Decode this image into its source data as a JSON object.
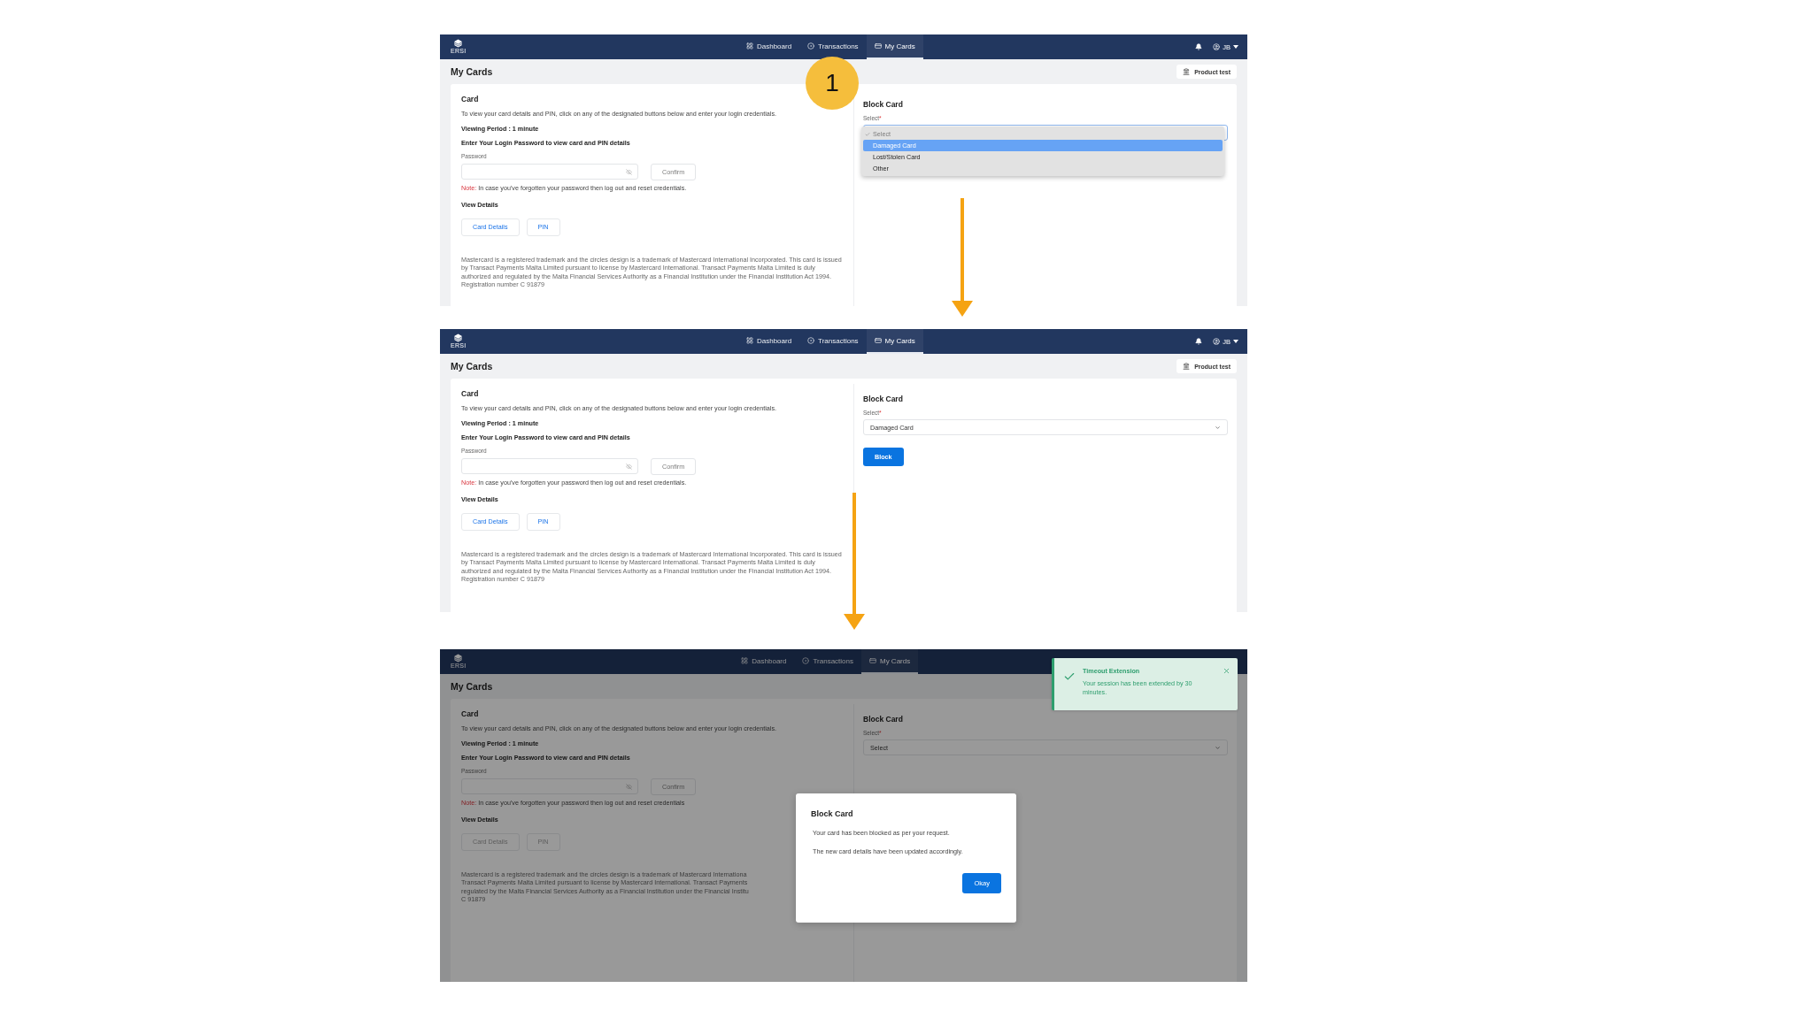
{
  "step_badge": "1",
  "screens": [
    {
      "nav": {
        "logo": "ERSI",
        "items": [
          {
            "label": "Dashboard",
            "selected": false
          },
          {
            "label": "Transactions",
            "selected": false
          },
          {
            "label": "My Cards",
            "selected": true
          }
        ],
        "user": "JB"
      },
      "page_title": "My Cards",
      "product_button": "Product test",
      "card": {
        "title": "Card",
        "intro": "To view your card details and PIN, click on any of the designated buttons below and enter your login credentials.",
        "viewing_period": "Viewing Period : 1 minute",
        "password_heading": "Enter Your Login Password to view card and PIN details",
        "password_label": "Password",
        "confirm": "Confirm",
        "note_label": "Note:",
        "note": "In case you've forgotten your password then log out and reset credentials.",
        "view_details": "View Details",
        "buttons": [
          {
            "label": "Card Details",
            "disabled": false
          },
          {
            "label": "PIN",
            "disabled": false
          }
        ],
        "disclaimer": "Mastercard is a registered trademark and the circles design is a trademark of Mastercard International Incorporated. This card is issued by Transact Payments Malta Limited pursuant to license by Mastercard International. Transact Payments Malta Limited is duly authorized and regulated by the Malta Financial Services Authority as a Financial Institution under the Financial Institution Act 1994. Registration number C 91879"
      },
      "block": {
        "title": "Block Card",
        "select_label": "Select",
        "required_mark": "*",
        "options": [
          {
            "label": "Select",
            "checked": true,
            "selected": false,
            "disabled": true
          },
          {
            "label": "Damaged Card",
            "checked": false,
            "selected": true,
            "disabled": false
          },
          {
            "label": "Lost/Stolen Card",
            "checked": false,
            "selected": false,
            "disabled": false
          },
          {
            "label": "Other",
            "checked": false,
            "selected": false,
            "disabled": false
          }
        ]
      }
    },
    {
      "nav": {
        "logo": "ERSI",
        "items": [
          {
            "label": "Dashboard",
            "selected": false
          },
          {
            "label": "Transactions",
            "selected": false
          },
          {
            "label": "My Cards",
            "selected": true
          }
        ],
        "user": "JB"
      },
      "page_title": "My Cards",
      "product_button": "Product test",
      "card": {
        "title": "Card",
        "intro": "To view your card details and PIN, click on any of the designated buttons below and enter your login credentials.",
        "viewing_period": "Viewing Period : 1 minute",
        "password_heading": "Enter Your Login Password to view card and PIN details",
        "password_label": "Password",
        "confirm": "Confirm",
        "note_label": "Note:",
        "note": "In case you've forgotten your password then log out and reset credentials.",
        "view_details": "View Details",
        "buttons": [
          {
            "label": "Card Details",
            "disabled": false
          },
          {
            "label": "PIN",
            "disabled": false
          }
        ],
        "disclaimer": "Mastercard is a registered trademark and the circles design is a trademark of Mastercard International Incorporated. This card is issued by Transact Payments Malta Limited pursuant to license by Mastercard International. Transact Payments Malta Limited is duly authorized and regulated by the Malta Financial Services Authority as a Financial Institution under the Financial Institution Act 1994. Registration number C 91879"
      },
      "block": {
        "title": "Block Card",
        "select_label": "Select",
        "required_mark": "*",
        "value": "Damaged Card",
        "block_button": "Block"
      }
    },
    {
      "nav": {
        "logo": "ERSI",
        "items": [
          {
            "label": "Dashboard",
            "selected": false
          },
          {
            "label": "Transactions",
            "selected": false
          },
          {
            "label": "My Cards",
            "selected": true
          }
        ]
      },
      "page_title": "My Cards",
      "card": {
        "title": "Card",
        "intro": "To view your card details and PIN, click on any of the designated buttons below and enter your login credentials.",
        "viewing_period": "Viewing Period : 1 minute",
        "password_heading": "Enter Your Login Password to view card and PIN details",
        "password_label": "Password",
        "confirm": "Confirm",
        "note_label": "Note:",
        "note": "In case you've forgotten your password then log out and reset credentials",
        "view_details": "View Details",
        "buttons": [
          {
            "label": "Card Details",
            "disabled": true
          },
          {
            "label": "PIN",
            "disabled": true
          }
        ],
        "disclaimer": [
          "Mastercard is a registered trademark and the circles design is a trademark of Mastercard Internationa",
          "Transact Payments Malta Limited pursuant to license by Mastercard International. Transact Payments",
          "regulated by the Malta Financial Services Authority as a Financial Institution under the Financial Institu",
          "C 91879"
        ]
      },
      "block": {
        "title": "Block Card",
        "select_label": "Select",
        "required_mark": "*",
        "value": "Select"
      },
      "modal": {
        "title": "Block Card",
        "lines": [
          "Your card has been blocked as per your request.",
          "The new card details have been updated accordingly."
        ],
        "button": "Okay"
      },
      "toast": {
        "title": "Timeout Extension",
        "message": "Your session has been extended by 30 minutes."
      }
    }
  ]
}
